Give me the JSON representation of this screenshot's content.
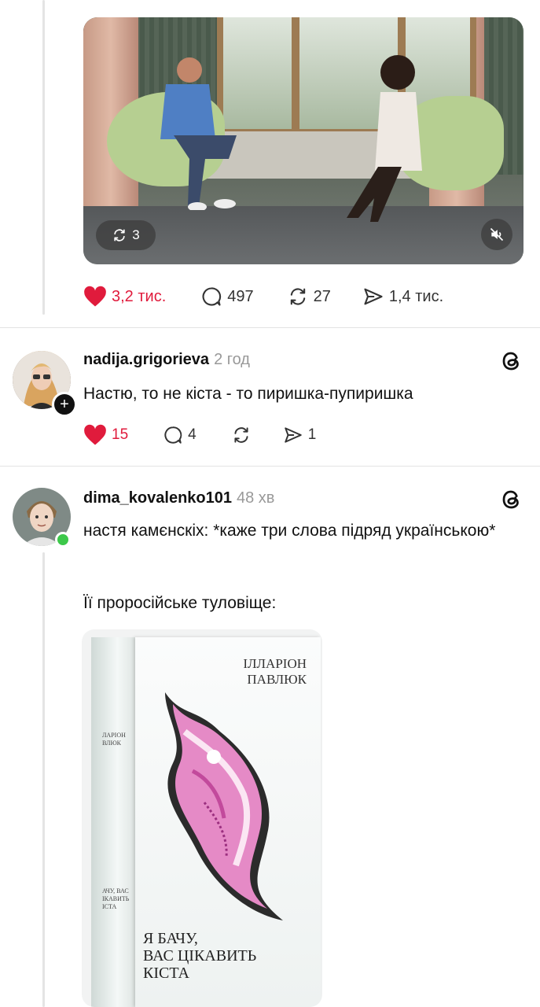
{
  "video": {
    "repost_count": "3",
    "repost_icon": "repost-icon",
    "mute_icon": "speaker-muted-icon"
  },
  "post_actions": {
    "likes": "3,2 тис.",
    "comments": "497",
    "reposts": "27",
    "shares": "1,4 тис."
  },
  "comments": [
    {
      "username": "nadija.grigorieva",
      "time": "2 год",
      "text": "Настю, то не кіста - то пиришка-пупиришка",
      "likes": "15",
      "replies": "4",
      "reposts": "",
      "shares": "1"
    },
    {
      "username": "dima_kovalenko101",
      "time": "48 хв",
      "text": "настя камєнскіх: *каже три слова підряд українською*",
      "text2": "Її проросійське туловіще:"
    }
  ],
  "book": {
    "author_line1": "ІЛЛАРІОН",
    "author_line2": "ПАВЛЮК",
    "title_line1": "Я БАЧУ,",
    "title_line2": "ВАС ЦІКАВИТЬ",
    "title_line3": "КІСТА",
    "spine_author1": "ЛАРІОН",
    "spine_author2": "ВЛЮК",
    "spine_title1": "АЧУ, ВАС",
    "spine_title2": "ІКАВИТЬ",
    "spine_title3": "ІСТА"
  },
  "colors": {
    "like": "#e01b3c",
    "muted_text": "#999999",
    "separator": "#e3e3e3"
  }
}
